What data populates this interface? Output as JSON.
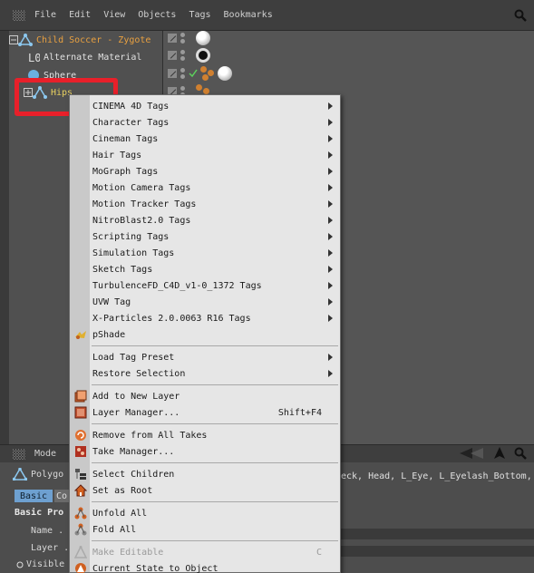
{
  "menubar": {
    "items": [
      "File",
      "Edit",
      "View",
      "Objects",
      "Tags",
      "Bookmarks"
    ]
  },
  "tree": {
    "objects": [
      {
        "label": "Child Soccer - Zygote",
        "color": "#e8a040"
      },
      {
        "label": "Alternate Material",
        "color": "#e0e0e0"
      },
      {
        "label": "Sphere",
        "color": "#e0e0e0"
      },
      {
        "label": "Hips",
        "color": "#e8d060"
      }
    ]
  },
  "highlight_color": "#e8202a",
  "context_menu": {
    "tag_groups": [
      "CINEMA 4D Tags",
      "Character Tags",
      "Cineman Tags",
      "Hair Tags",
      "MoGraph Tags",
      "Motion Camera Tags",
      "Motion Tracker Tags",
      "NitroBlast2.0 Tags",
      "Scripting Tags",
      "Simulation Tags",
      "Sketch Tags",
      "TurbulenceFD_C4D_v1-0_1372 Tags",
      "UVW Tag",
      "X-Particles 2.0.0063 R16 Tags"
    ],
    "pshade": "pShade",
    "load_tag_preset": "Load Tag Preset",
    "restore_selection": "Restore Selection",
    "add_to_new_layer": "Add to New Layer",
    "layer_manager": "Layer Manager...",
    "layer_manager_shortcut": "Shift+F4",
    "remove_from_all_takes": "Remove from All Takes",
    "take_manager": "Take Manager...",
    "select_children": "Select Children",
    "set_as_root": "Set as Root",
    "unfold_all": "Unfold All",
    "fold_all": "Fold All",
    "make_editable": "Make Editable",
    "make_editable_shortcut": "C",
    "current_state_to_object": "Current State to Object"
  },
  "attributes": {
    "mode": "Mode",
    "object_type": "Polygo",
    "tab_basic": "Basic",
    "tab_co": "Co",
    "section": "Basic Pro",
    "name_label": "Name . .",
    "layer_label": "Layer . .",
    "visible_label": "Visible",
    "selection_text": "eck, Head, L_Eye, L_Eyelash_Bottom,"
  }
}
